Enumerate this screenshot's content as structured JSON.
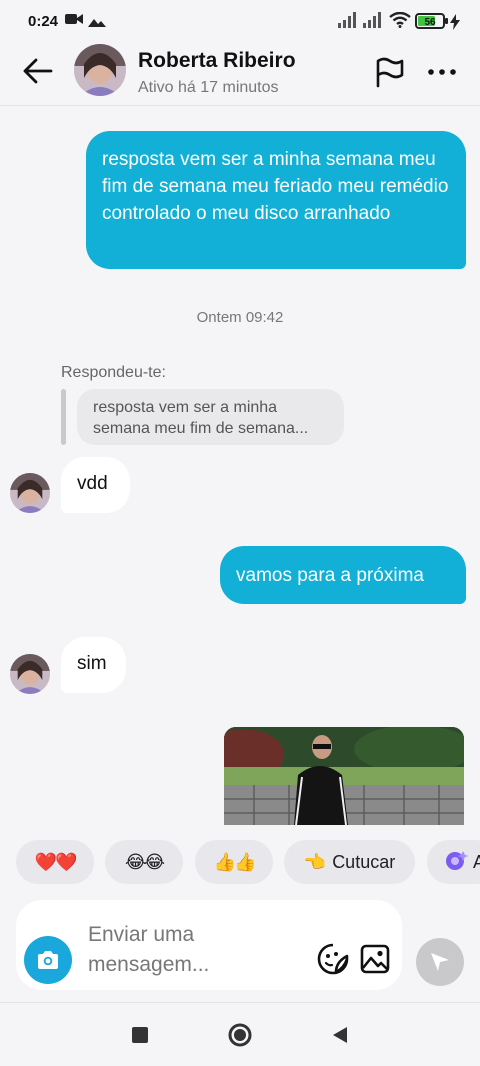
{
  "status_bar": {
    "time": "0:24",
    "battery": "56",
    "icons": [
      "video-icon",
      "cloud-icon",
      "signal-icon",
      "signal-icon",
      "wifi-icon",
      "battery-icon",
      "charging-icon"
    ]
  },
  "header": {
    "name": "Roberta Ribeiro",
    "status": "Ativo há 17 minutos",
    "icons": [
      "back-arrow-icon",
      "flag-icon",
      "more-icon"
    ]
  },
  "messages": {
    "out_1": "resposta vem ser a minha semana meu fim de semana meu feriado meu remédio controlado o meu disco arranhado",
    "timestamp": "Ontem 09:42",
    "reply_label": "Respondeu-te:",
    "reply_quote": "resposta vem ser a minha semana meu fim de semana...",
    "in_1": "vdd",
    "out_2": "vamos para a próxima",
    "in_2": "sim"
  },
  "quick_reactions": {
    "hearts": "❤️❤️",
    "laughs": "😂😂",
    "thumbs": "👍👍",
    "poke_emoji": "👈",
    "poke_label": "Cutucar",
    "extra_label": "A"
  },
  "composer": {
    "placeholder": "Enviar uma mensagem...",
    "icons": [
      "camera-icon",
      "sticker-icon",
      "gallery-icon",
      "send-icon"
    ]
  },
  "colors": {
    "accent": "#12b0d6",
    "camera": "#1aa8dc",
    "background": "#f5f5f7"
  }
}
